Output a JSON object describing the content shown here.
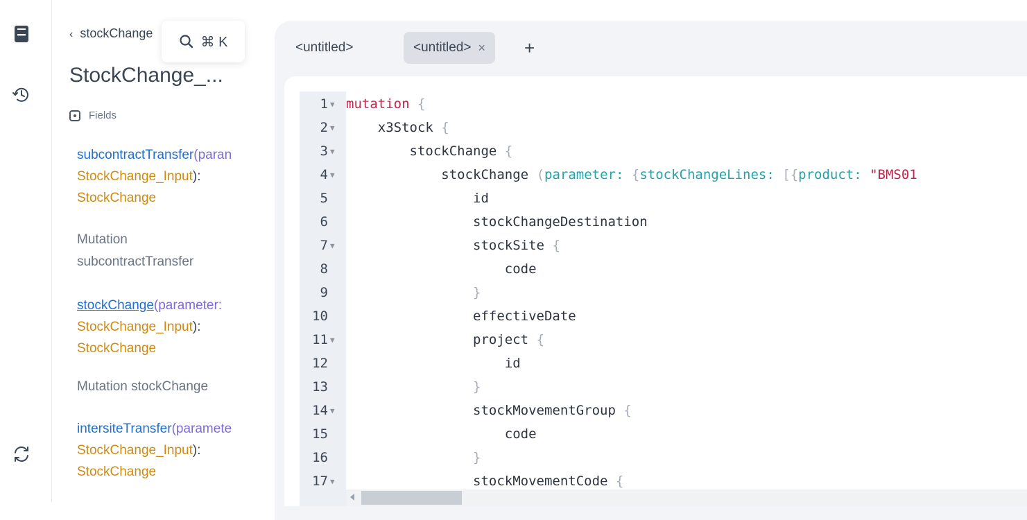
{
  "rail": {
    "icons": [
      "doc-explorer-icon",
      "history-icon",
      "refetch-schema-icon"
    ]
  },
  "docs": {
    "back_label": "stockChange",
    "search_shortcut": "⌘ K",
    "type_title": "StockChange_...",
    "fields_heading": "Fields",
    "fields": [
      {
        "name": "subcontractTransfer",
        "open": "(",
        "arg": "paran",
        "type_line2": "StockChange_Input",
        "close": "):",
        "return_type": "StockChange",
        "description_l1": "Mutation",
        "description_l2": "subcontractTransfer"
      },
      {
        "name": "stockChange",
        "open": "(",
        "arg": "parameter:",
        "type_line2": "StockChange_Input",
        "close": "):",
        "return_type": "StockChange",
        "description_l1": "Mutation stockChange"
      },
      {
        "name": "intersiteTransfer",
        "open": "(",
        "arg": "paramete",
        "type_line2": "StockChange_Input",
        "close": "):",
        "return_type": "StockChange"
      }
    ]
  },
  "tabs": [
    {
      "label": "<untitled>",
      "active": false
    },
    {
      "label": "<untitled>",
      "active": true,
      "close": "×"
    }
  ],
  "add_tab": "+",
  "editor": {
    "lines": [
      {
        "n": "1",
        "fold": true
      },
      {
        "n": "2",
        "fold": true
      },
      {
        "n": "3",
        "fold": true
      },
      {
        "n": "4",
        "fold": true
      },
      {
        "n": "5",
        "fold": false
      },
      {
        "n": "6",
        "fold": false
      },
      {
        "n": "7",
        "fold": true
      },
      {
        "n": "8",
        "fold": false
      },
      {
        "n": "9",
        "fold": false
      },
      {
        "n": "10",
        "fold": false
      },
      {
        "n": "11",
        "fold": true
      },
      {
        "n": "12",
        "fold": false
      },
      {
        "n": "13",
        "fold": false
      },
      {
        "n": "14",
        "fold": true
      },
      {
        "n": "15",
        "fold": false
      },
      {
        "n": "16",
        "fold": false
      },
      {
        "n": "17",
        "fold": true
      }
    ],
    "tokens": {
      "l1_kw": "mutation",
      "brace_open": "{",
      "brace_close": "}",
      "l2": "x3Stock",
      "l3": "stockChange",
      "l4_field": "stockChange",
      "l4_paren": "(",
      "l4_arg": "parameter:",
      "l4_obj": "{",
      "l4_key": "stockChangeLines:",
      "l4_arr": "[{",
      "l4_prod": "product:",
      "l4_str": "\"BMS01",
      "l5": "id",
      "l6": "stockChangeDestination",
      "l7": "stockSite",
      "l8": "code",
      "l10": "effectiveDate",
      "l11": "project",
      "l12": "id",
      "l14": "stockMovementGroup",
      "l15": "code",
      "l17": "stockMovementCode"
    }
  }
}
